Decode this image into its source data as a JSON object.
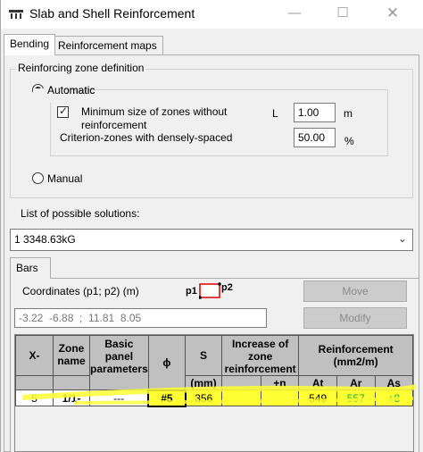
{
  "window": {
    "title": "Slab and Shell Reinforcement",
    "min": "—",
    "max": "☐",
    "close": "✕"
  },
  "tabs": {
    "bending": "Bending",
    "maps": "Reinforcement maps"
  },
  "zone": {
    "legend": "Reinforcing zone definition",
    "automatic": "Automatic",
    "min_size_line1": "Minimum size of zones without",
    "min_size_line2": "reinforcement",
    "criterion": "Criterion-zones with densely-spaced",
    "l_label": "L",
    "l_value": "1.00",
    "l_unit": "m",
    "crit_value": "50.00",
    "crit_unit": "%",
    "manual": "Manual"
  },
  "solutions": {
    "label": "List of possible solutions:",
    "selected": "1    3348.63kG"
  },
  "bars": {
    "tab": "Bars",
    "coord_label": "Coordinates (p1; p2) (m)",
    "p1": "p1",
    "p2": "p2",
    "coord_value": "-3.22  -6.88  ;  11.81  8.05",
    "move": "Move",
    "modify": "Modify"
  },
  "table": {
    "headers": {
      "x": "X-",
      "zone": "Zone name",
      "basic": "Basic panel parameters",
      "phi": "ϕ",
      "s": "S",
      "increase": "Increase of zone reinforcement",
      "reinf": "Reinforcement (mm2/m)",
      "s_unit": "(mm)",
      "plus_n": "+n",
      "at": "At",
      "ar": "Ar",
      "as": "As"
    },
    "row": {
      "x": "5",
      "zone": "1/1-",
      "basic": "---",
      "phi": "#5",
      "s": "356",
      "inc1": "",
      "inc2": "",
      "at": "549",
      "ar": "557",
      "as": "+8"
    }
  },
  "colors": {
    "highlight": "#ffff33",
    "green_value": "#22aa22",
    "p_box": "#e00000"
  }
}
